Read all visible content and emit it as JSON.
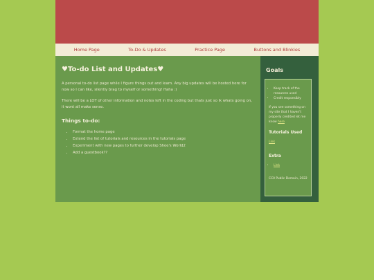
{
  "nav": {
    "items": [
      "Home Page",
      "To-Do & Updates",
      "Practice Page",
      "Buttons and Blinkies"
    ]
  },
  "main": {
    "title": "♥To-do List and Updates♥",
    "intro": "A personal to-do list page while I figure things out and learn. Any big updates will be hosted here for now so I can like, silently brag to myself or something! Haha :)",
    "info": "There will be a LOT of other information and notes left in the coding but thats just so ik whats going on, it wont all make sense.",
    "todo_heading": "Things to-do:",
    "todos": [
      "Format the home page",
      "Extend the list of tutorials and resources in the tutorials page",
      "Experiment with new pages to further develop Shoe's World2",
      "Add a guestbook??"
    ]
  },
  "sidebar": {
    "goals_title": "Goals",
    "goals": [
      "Keep track of the resources used",
      "Credit responsibly"
    ],
    "note": "If you see something on my site that I haven't properly credited let me know",
    "note_link": "here",
    "tutorials_title": "Tutorials Used",
    "tutorials_link": "Link",
    "extra_title": "Extra",
    "extra_link": "Link",
    "footer": "CC0 Public Domain, 2022"
  }
}
